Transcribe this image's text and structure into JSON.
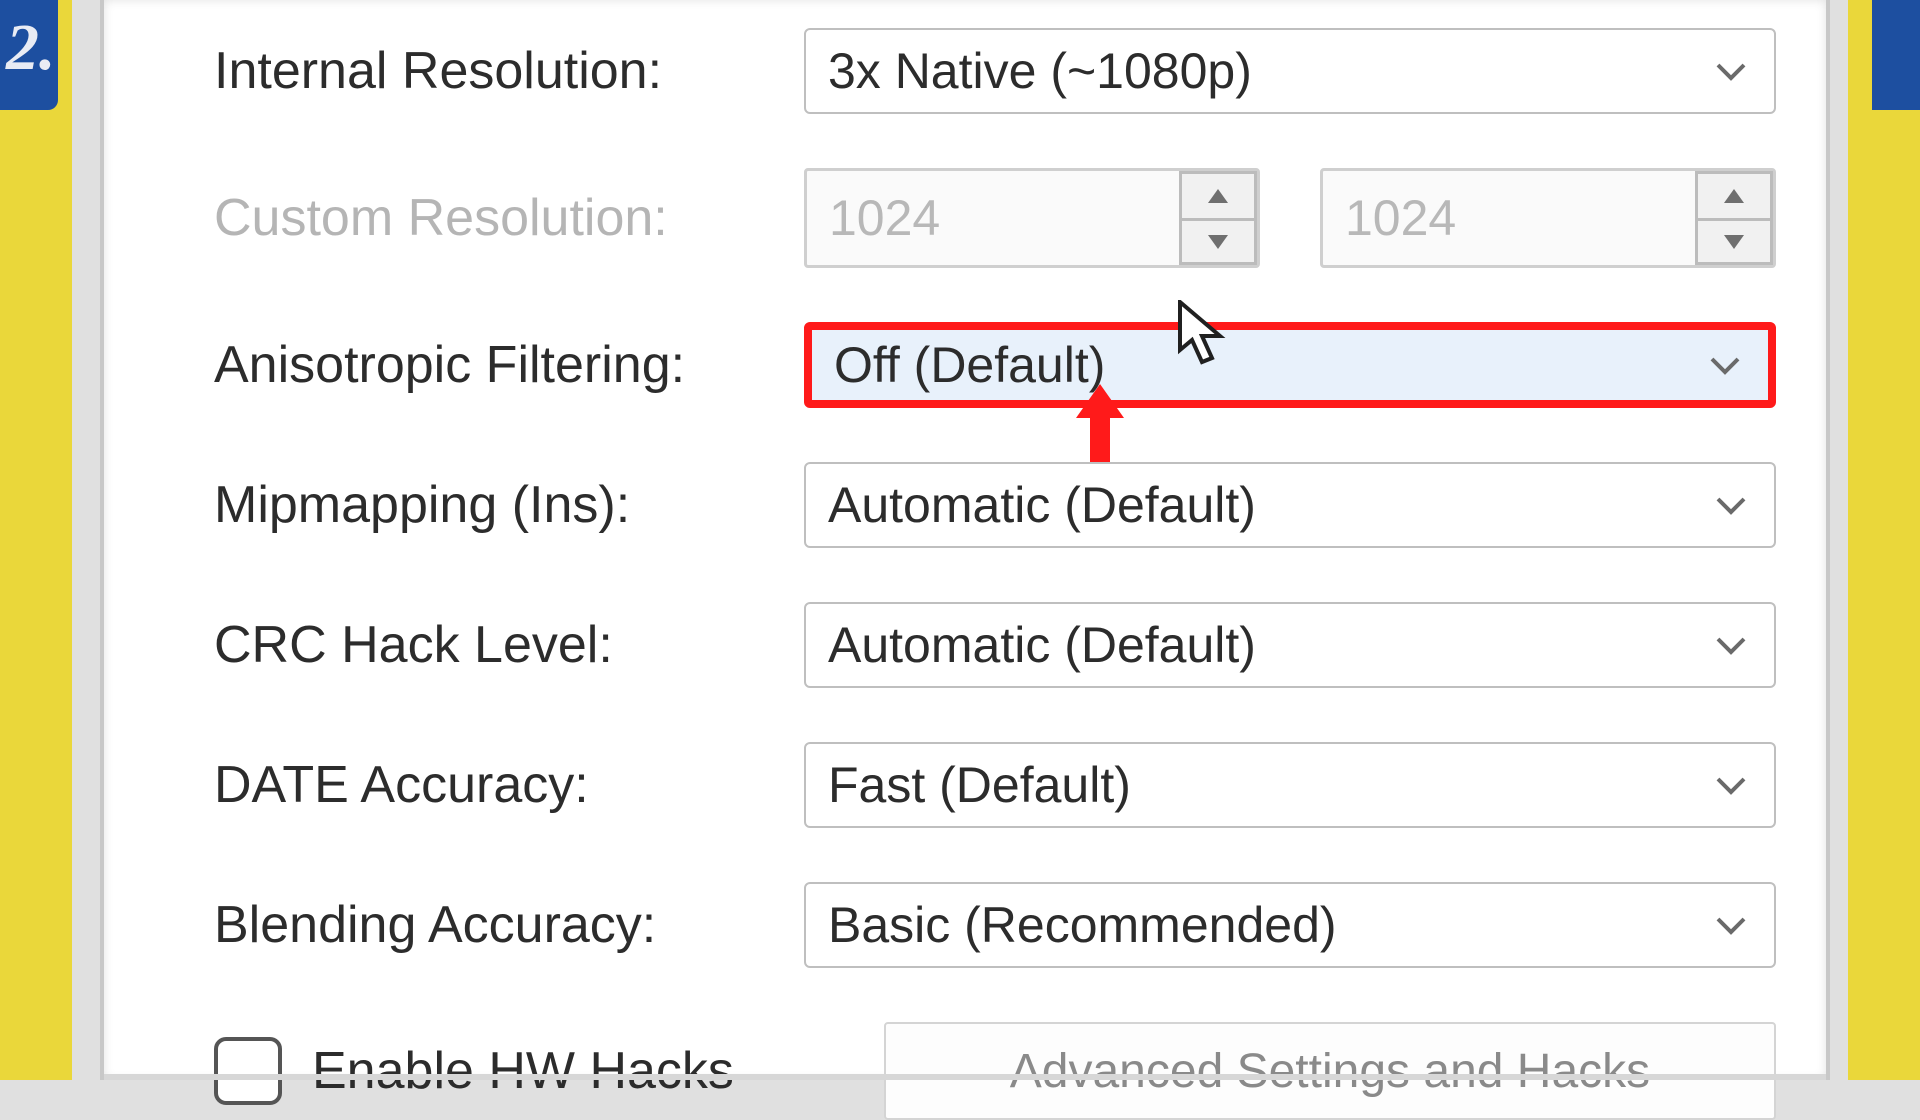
{
  "badge": "2.",
  "settings": {
    "internal_resolution": {
      "label": "Internal Resolution:",
      "value": "3x Native (~1080p)"
    },
    "custom_resolution": {
      "label": "Custom Resolution:",
      "width": "1024",
      "height": "1024"
    },
    "anisotropic": {
      "label": "Anisotropic Filtering:",
      "value": "Off (Default)"
    },
    "mipmapping": {
      "label": "Mipmapping (Ins):",
      "value": "Automatic (Default)"
    },
    "crc_hack": {
      "label": "CRC Hack Level:",
      "value": "Automatic (Default)"
    },
    "date_accuracy": {
      "label": "DATE Accuracy:",
      "value": "Fast (Default)"
    },
    "blending": {
      "label": "Blending Accuracy:",
      "value": "Basic (Recommended)"
    },
    "hw_hacks": {
      "label": "Enable HW Hacks"
    },
    "advanced_btn": "Advanced Settings and Hacks"
  }
}
